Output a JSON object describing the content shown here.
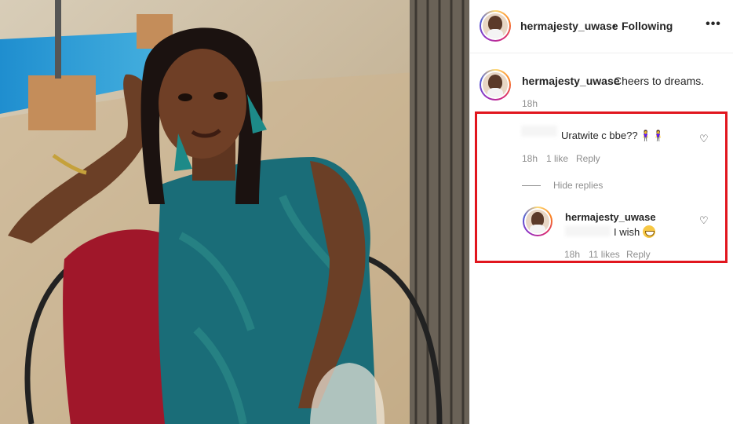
{
  "post": {
    "username": "hermajesty_uwase",
    "follow_separator": "•",
    "follow_label": "Following",
    "more_icon": "more-icon"
  },
  "caption": {
    "username": "hermajesty_uwase",
    "text": "Cheers to dreams.",
    "time": "18h"
  },
  "comments": [
    {
      "text": "Uratwite c bbe??",
      "emoji": "🧍‍♀️🧍‍♀️",
      "time": "18h",
      "likes": "1 like",
      "reply_label": "Reply",
      "hide_replies_label": "Hide replies",
      "replies": [
        {
          "username": "hermajesty_uwase",
          "text": "I wish",
          "emoji_icon": "grinning-face-icon",
          "time": "18h",
          "likes": "11 likes",
          "reply_label": "Reply"
        }
      ]
    }
  ],
  "colors": {
    "highlight_border": "#e1161e",
    "muted_text": "#8e8e8e",
    "primary_text": "#262626"
  }
}
